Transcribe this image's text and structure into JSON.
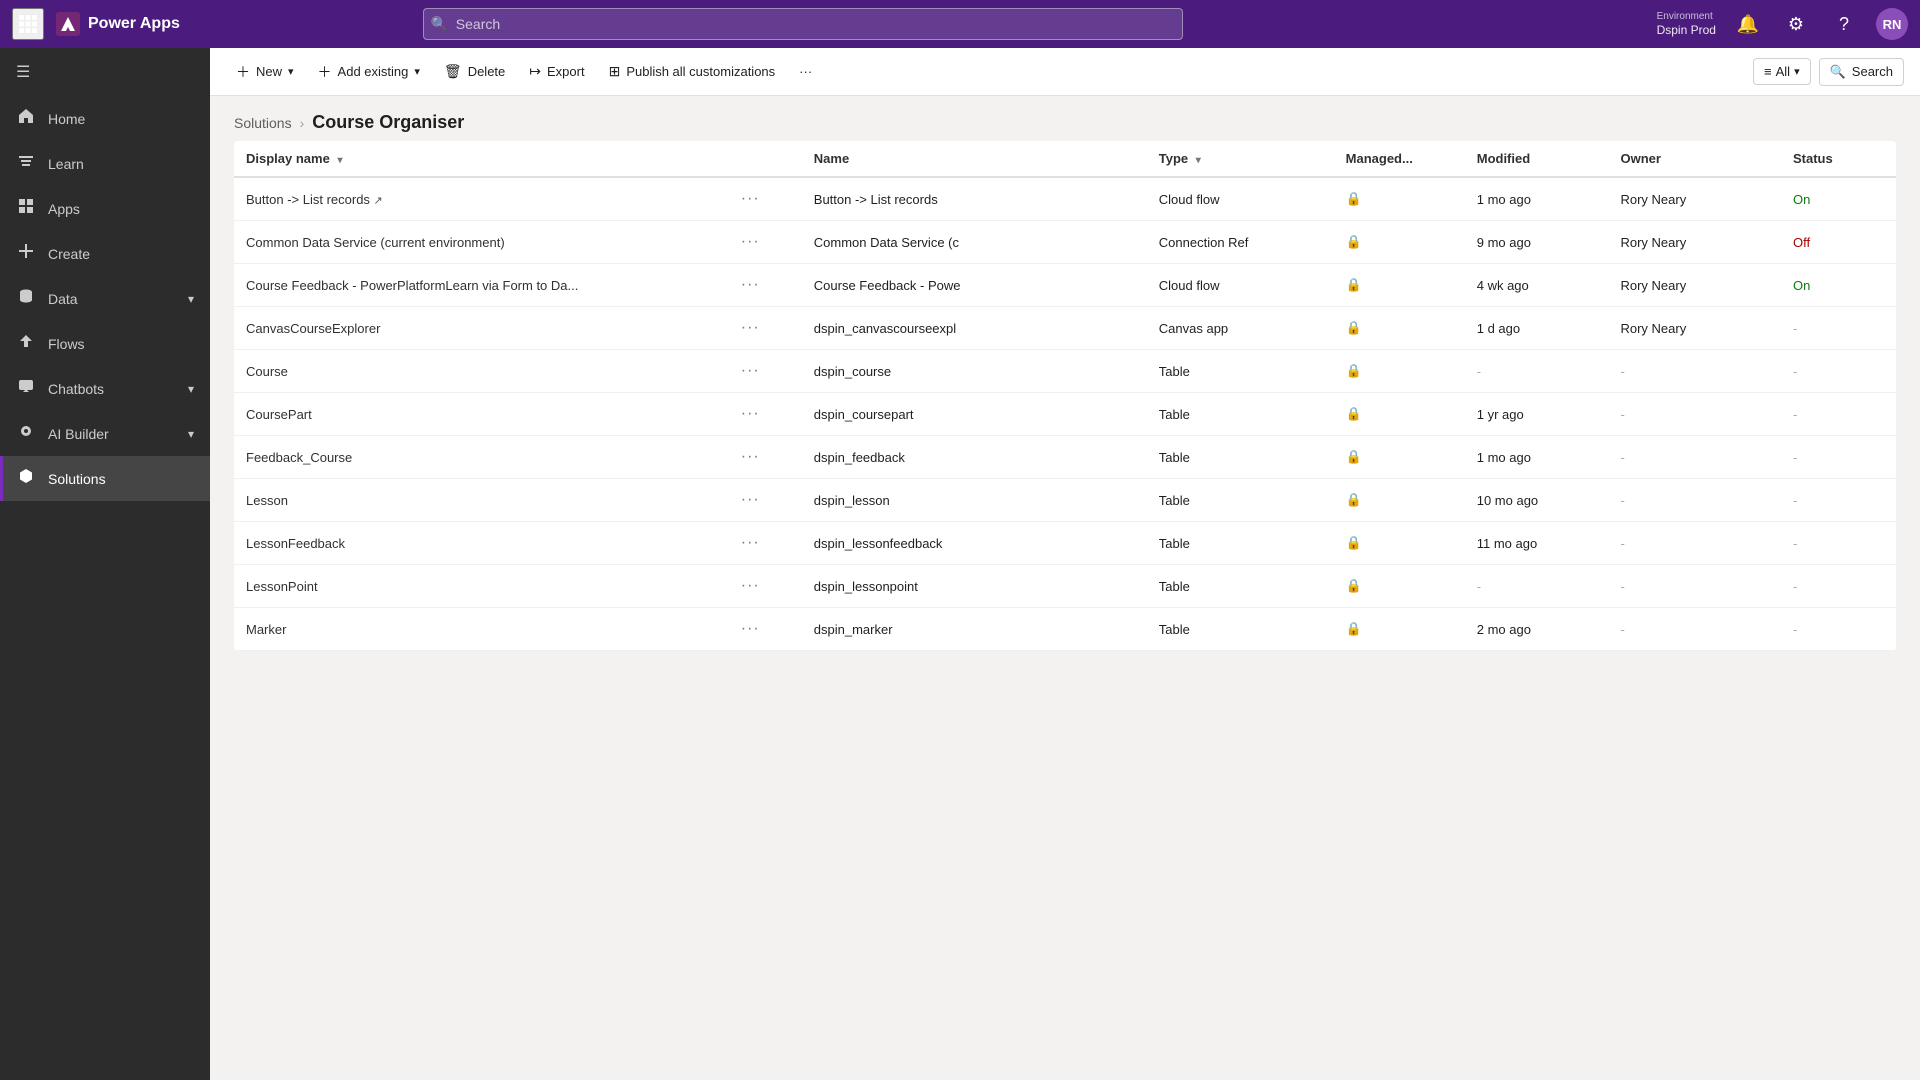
{
  "topbar": {
    "app_name": "Power Apps",
    "search_placeholder": "Search",
    "search_value": "",
    "environment_label": "Environment",
    "environment_name": "Dspin Prod",
    "avatar_initials": "RN"
  },
  "sidebar": {
    "toggle_label": "Collapse",
    "items": [
      {
        "id": "home",
        "label": "Home",
        "icon": "🏠",
        "active": false,
        "expandable": false
      },
      {
        "id": "learn",
        "label": "Learn",
        "icon": "📖",
        "active": false,
        "expandable": false
      },
      {
        "id": "apps",
        "label": "Apps",
        "icon": "⊞",
        "active": false,
        "expandable": false
      },
      {
        "id": "create",
        "label": "Create",
        "icon": "➕",
        "active": false,
        "expandable": false
      },
      {
        "id": "data",
        "label": "Data",
        "icon": "🗄",
        "active": false,
        "expandable": true
      },
      {
        "id": "flows",
        "label": "Flows",
        "icon": "↗",
        "active": false,
        "expandable": false
      },
      {
        "id": "chatbots",
        "label": "Chatbots",
        "icon": "💬",
        "active": false,
        "expandable": true
      },
      {
        "id": "ai-builder",
        "label": "AI Builder",
        "icon": "🤖",
        "active": false,
        "expandable": true
      },
      {
        "id": "solutions",
        "label": "Solutions",
        "icon": "⬡",
        "active": true,
        "expandable": false
      }
    ]
  },
  "toolbar": {
    "new_label": "New",
    "add_existing_label": "Add existing",
    "delete_label": "Delete",
    "export_label": "Export",
    "publish_label": "Publish all customizations",
    "more_label": "···",
    "all_label": "All",
    "search_label": "Search"
  },
  "breadcrumb": {
    "parent_label": "Solutions",
    "current_label": "Course Organiser"
  },
  "table": {
    "columns": [
      {
        "id": "display_name",
        "label": "Display name",
        "sortable": true
      },
      {
        "id": "menu",
        "label": ""
      },
      {
        "id": "name",
        "label": "Name"
      },
      {
        "id": "type",
        "label": "Type",
        "sortable": true
      },
      {
        "id": "managed",
        "label": "Managed..."
      },
      {
        "id": "modified",
        "label": "Modified"
      },
      {
        "id": "owner",
        "label": "Owner"
      },
      {
        "id": "status",
        "label": "Status"
      }
    ],
    "rows": [
      {
        "display_name": "Button -> List records",
        "has_link": true,
        "name": "Button -> List records",
        "type": "Cloud flow",
        "managed_icon": true,
        "modified": "1 mo ago",
        "owner": "Rory Neary",
        "status": "On",
        "status_type": "on"
      },
      {
        "display_name": "Common Data Service (current environment)",
        "has_link": false,
        "name": "Common Data Service (c",
        "type": "Connection Ref",
        "managed_icon": true,
        "modified": "9 mo ago",
        "owner": "Rory Neary",
        "status": "Off",
        "status_type": "off"
      },
      {
        "display_name": "Course Feedback - PowerPlatformLearn via Form to Da...",
        "has_link": false,
        "name": "Course Feedback - Powe",
        "type": "Cloud flow",
        "managed_icon": true,
        "modified": "4 wk ago",
        "owner": "Rory Neary",
        "status": "On",
        "status_type": "on"
      },
      {
        "display_name": "CanvasCourseExplorer",
        "has_link": false,
        "name": "dspin_canvascourseexpl",
        "type": "Canvas app",
        "managed_icon": true,
        "modified": "1 d ago",
        "owner": "Rory Neary",
        "status": "-",
        "status_type": "dash"
      },
      {
        "display_name": "Course",
        "has_link": false,
        "name": "dspin_course",
        "type": "Table",
        "managed_icon": true,
        "modified": "-",
        "owner": "-",
        "status": "-",
        "status_type": "dash"
      },
      {
        "display_name": "CoursePart",
        "has_link": false,
        "name": "dspin_coursepart",
        "type": "Table",
        "managed_icon": true,
        "modified": "1 yr ago",
        "owner": "-",
        "status": "-",
        "status_type": "dash"
      },
      {
        "display_name": "Feedback_Course",
        "has_link": false,
        "name": "dspin_feedback",
        "type": "Table",
        "managed_icon": true,
        "modified": "1 mo ago",
        "owner": "-",
        "status": "-",
        "status_type": "dash"
      },
      {
        "display_name": "Lesson",
        "has_link": false,
        "name": "dspin_lesson",
        "type": "Table",
        "managed_icon": true,
        "modified": "10 mo ago",
        "owner": "-",
        "status": "-",
        "status_type": "dash"
      },
      {
        "display_name": "LessonFeedback",
        "has_link": false,
        "name": "dspin_lessonfeedback",
        "type": "Table",
        "managed_icon": true,
        "modified": "11 mo ago",
        "owner": "-",
        "status": "-",
        "status_type": "dash"
      },
      {
        "display_name": "LessonPoint",
        "has_link": false,
        "name": "dspin_lessonpoint",
        "type": "Table",
        "managed_icon": true,
        "modified": "-",
        "owner": "-",
        "status": "-",
        "status_type": "dash"
      },
      {
        "display_name": "Marker",
        "has_link": false,
        "name": "dspin_marker",
        "type": "Table",
        "managed_icon": true,
        "modified": "2 mo ago",
        "owner": "-",
        "status": "-",
        "status_type": "dash"
      }
    ]
  }
}
